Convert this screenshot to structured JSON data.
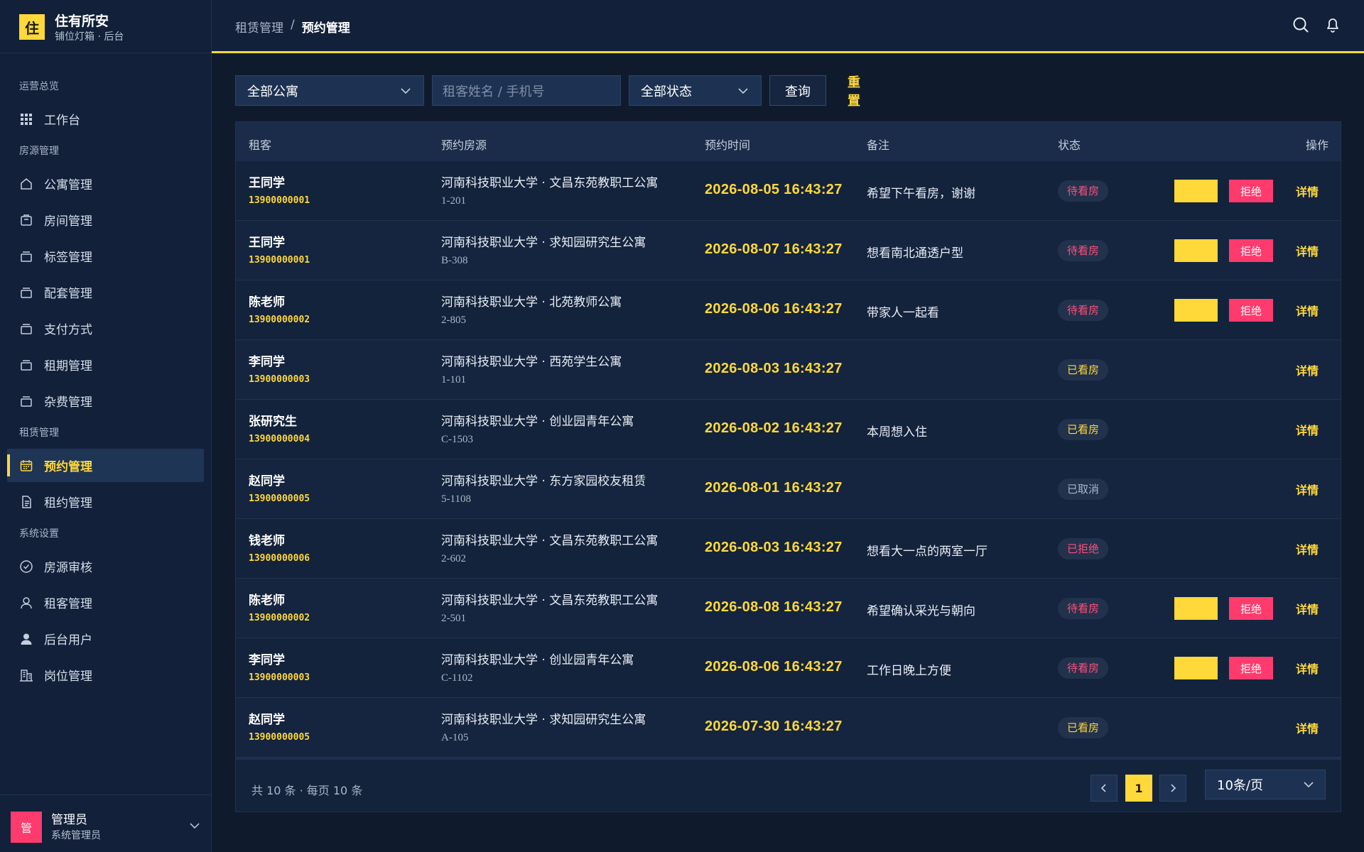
{
  "brand": {
    "logo": "住",
    "name": "住有所安",
    "subtitle": "铺位灯箱 · 后台"
  },
  "sidebar": {
    "groups": [
      {
        "label": "运营总览",
        "items": [
          {
            "label": "工作台",
            "icon": "grid-icon"
          }
        ]
      },
      {
        "label": "房源管理",
        "items": [
          {
            "label": "公寓管理",
            "icon": "house-icon"
          },
          {
            "label": "房间管理",
            "icon": "box-icon"
          },
          {
            "label": "标签管理",
            "icon": "tray-icon"
          },
          {
            "label": "配套管理",
            "icon": "tray-icon"
          },
          {
            "label": "支付方式",
            "icon": "tray-icon"
          },
          {
            "label": "租期管理",
            "icon": "tray-icon"
          },
          {
            "label": "杂费管理",
            "icon": "tray-icon"
          }
        ]
      },
      {
        "label": "租赁管理",
        "items": [
          {
            "label": "预约管理",
            "icon": "calendar-icon",
            "active": true
          },
          {
            "label": "租约管理",
            "icon": "document-icon"
          }
        ]
      },
      {
        "label": "系统设置",
        "items": [
          {
            "label": "房源审核",
            "icon": "check-circle-icon"
          },
          {
            "label": "租客管理",
            "icon": "user-outline-icon"
          },
          {
            "label": "后台用户",
            "icon": "user-filled-icon"
          },
          {
            "label": "岗位管理",
            "icon": "building-icon"
          }
        ]
      }
    ]
  },
  "user": {
    "avatar": "管",
    "name": "管理员",
    "role": "系统管理员"
  },
  "header": {
    "breadcrumb_parent": "租赁管理",
    "breadcrumb_sep": "/",
    "breadcrumb_current": "预约管理"
  },
  "filters": {
    "apartment": "全部公寓",
    "search_placeholder": "租客姓名 / 手机号",
    "status": "全部状态",
    "query": "查询",
    "reset": "重置"
  },
  "table": {
    "columns": {
      "tenant": "租客",
      "source": "预约房源",
      "time": "预约时间",
      "note": "备注",
      "status": "状态",
      "action": "操作"
    },
    "reject_label": "拒绝",
    "detail_label": "详情",
    "rows": [
      {
        "name": "王同学",
        "phone": "13900000001",
        "apartment": "河南科技职业大学 · 文昌东苑教职工公寓",
        "room": "1-201",
        "time": "2026-08-05 16:43:27",
        "note": "希望下午看房，谢谢",
        "status": "待看房",
        "status_type": "pending"
      },
      {
        "name": "王同学",
        "phone": "13900000001",
        "apartment": "河南科技职业大学 · 求知园研究生公寓",
        "room": "B-308",
        "time": "2026-08-07 16:43:27",
        "note": "想看南北通透户型",
        "status": "待看房",
        "status_type": "pending"
      },
      {
        "name": "陈老师",
        "phone": "13900000002",
        "apartment": "河南科技职业大学 · 北苑教师公寓",
        "room": "2-805",
        "time": "2026-08-06 16:43:27",
        "note": "带家人一起看",
        "status": "待看房",
        "status_type": "pending"
      },
      {
        "name": "李同学",
        "phone": "13900000003",
        "apartment": "河南科技职业大学 · 西苑学生公寓",
        "room": "1-101",
        "time": "2026-08-03 16:43:27",
        "note": "",
        "status": "已看房",
        "status_type": "visited"
      },
      {
        "name": "张研究生",
        "phone": "13900000004",
        "apartment": "河南科技职业大学 · 创业园青年公寓",
        "room": "C-1503",
        "time": "2026-08-02 16:43:27",
        "note": "本周想入住",
        "status": "已看房",
        "status_type": "visited"
      },
      {
        "name": "赵同学",
        "phone": "13900000005",
        "apartment": "河南科技职业大学 · 东方家园校友租赁",
        "room": "5-1108",
        "time": "2026-08-01 16:43:27",
        "note": "",
        "status": "已取消",
        "status_type": "cancel"
      },
      {
        "name": "钱老师",
        "phone": "13900000006",
        "apartment": "河南科技职业大学 · 文昌东苑教职工公寓",
        "room": "2-602",
        "time": "2026-08-03 16:43:27",
        "note": "想看大一点的两室一厅",
        "status": "已拒绝",
        "status_type": "reject"
      },
      {
        "name": "陈老师",
        "phone": "13900000002",
        "apartment": "河南科技职业大学 · 文昌东苑教职工公寓",
        "room": "2-501",
        "time": "2026-08-08 16:43:27",
        "note": "希望确认采光与朝向",
        "status": "待看房",
        "status_type": "pending"
      },
      {
        "name": "李同学",
        "phone": "13900000003",
        "apartment": "河南科技职业大学 · 创业园青年公寓",
        "room": "C-1102",
        "time": "2026-08-06 16:43:27",
        "note": "工作日晚上方便",
        "status": "待看房",
        "status_type": "pending"
      },
      {
        "name": "赵同学",
        "phone": "13900000005",
        "apartment": "河南科技职业大学 · 求知园研究生公寓",
        "room": "A-105",
        "time": "2026-07-30 16:43:27",
        "note": "",
        "status": "已看房",
        "status_type": "visited"
      }
    ]
  },
  "pagination": {
    "summary": "共 10 条 · 每页 10 条",
    "current_page": "1",
    "page_size": "10条/页"
  },
  "colors": {
    "accent": "#ffd83a",
    "danger": "#ff3b6e",
    "background": "#0f1b2d"
  }
}
